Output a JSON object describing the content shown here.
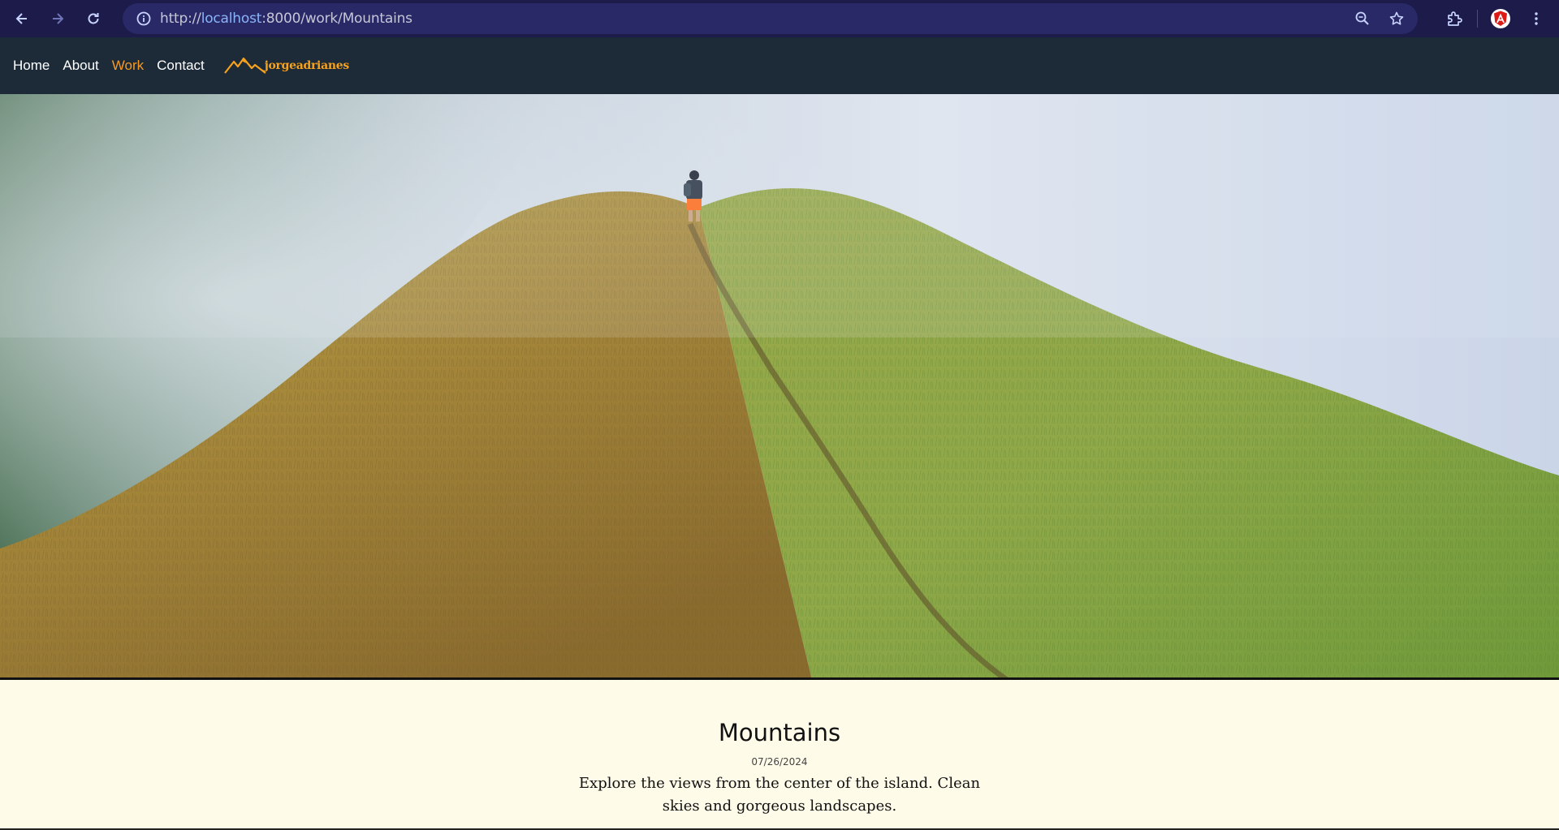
{
  "browser": {
    "url_scheme": "http://",
    "url_host": "localhost",
    "url_rest": ":8000/work/Mountains",
    "icons": [
      "back-icon",
      "forward-icon",
      "reload-icon",
      "site-info-icon",
      "zoom-icon",
      "bookmark-star-icon",
      "extensions-icon",
      "profile-icon",
      "menu-kebab-icon"
    ]
  },
  "nav": {
    "items": [
      {
        "label": "Home",
        "active": false
      },
      {
        "label": "About",
        "active": false
      },
      {
        "label": "Work",
        "active": true
      },
      {
        "label": "Contact",
        "active": false
      }
    ],
    "logo_text": "jorgeadrianes"
  },
  "colors": {
    "chrome_bg": "#1c1b4a",
    "nav_bg": "#1d2a38",
    "accent": "#f59a23",
    "page_bg": "#fefbe8"
  },
  "article": {
    "title": "Mountains",
    "date": "07/26/2024",
    "description": "Explore the views from the center of the island. Clean skies and gorgeous landscapes."
  }
}
